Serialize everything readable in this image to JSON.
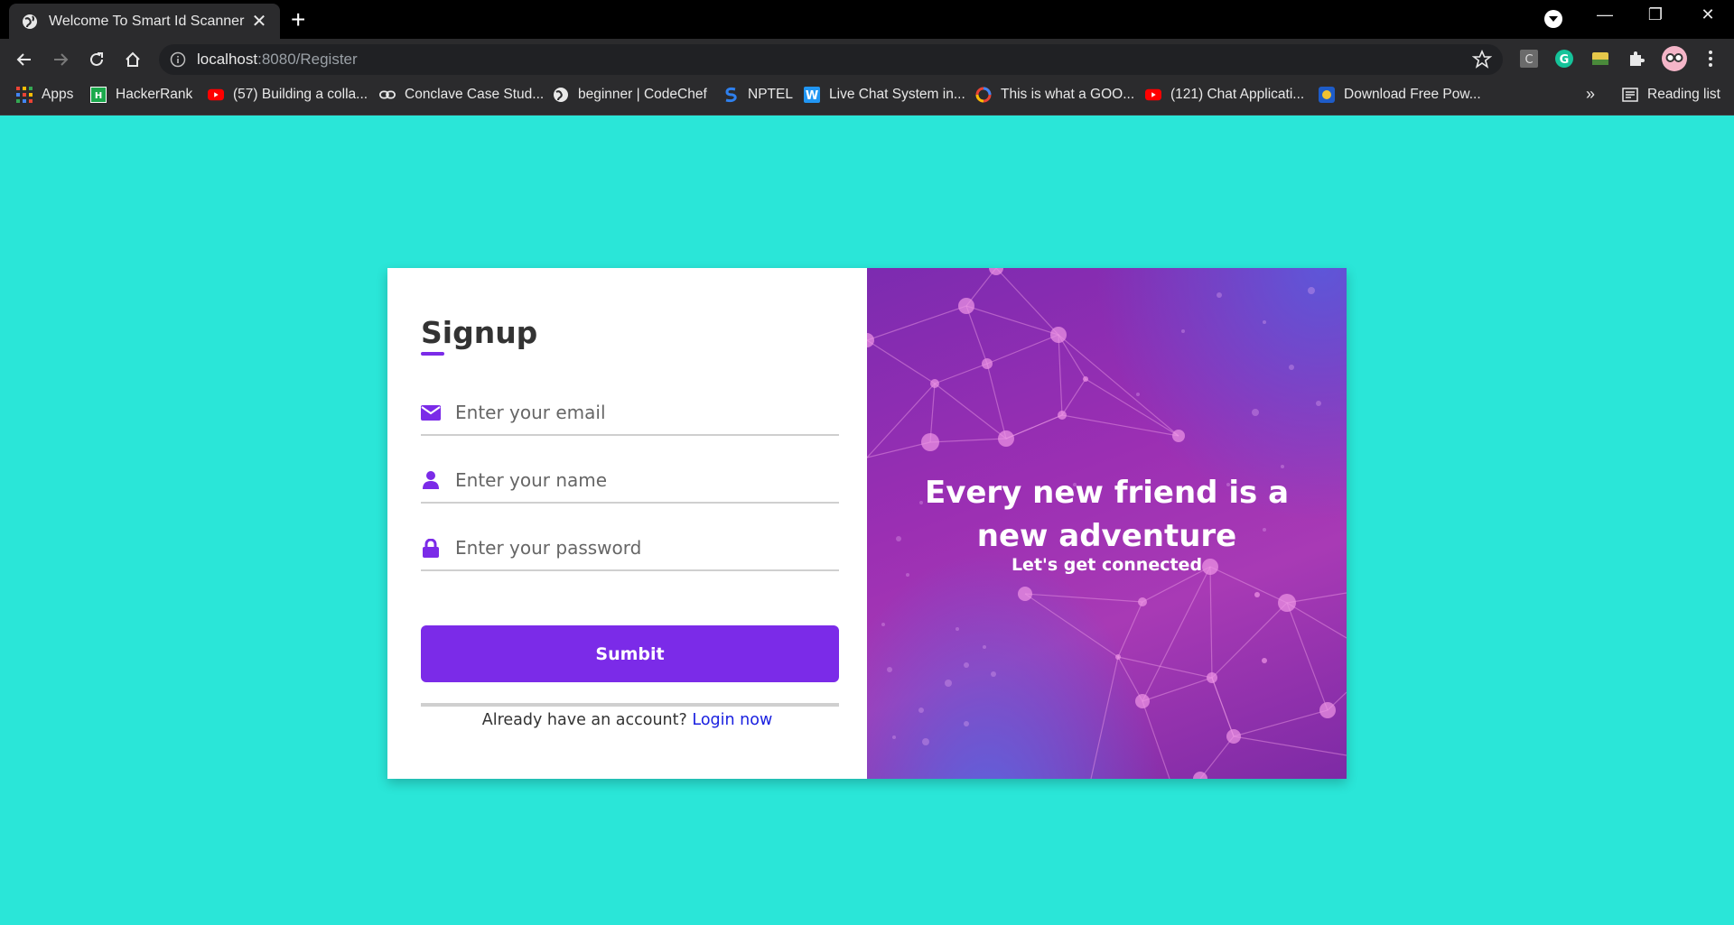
{
  "browser": {
    "tab_title": "Welcome To Smart Id Scanner",
    "tab_close": "✕",
    "new_tab": "+",
    "url_host": "localhost",
    "url_path": ":8080/Register",
    "window_controls": {
      "minimize": "—",
      "restore": "❐",
      "close": "✕"
    }
  },
  "bookmarks": [
    {
      "label": "Apps",
      "icon": "apps-grid-icon"
    },
    {
      "label": "HackerRank",
      "icon": "hackerrank-icon"
    },
    {
      "label": "(57) Building a colla...",
      "icon": "youtube-icon"
    },
    {
      "label": "Conclave Case Stud...",
      "icon": "link-icon"
    },
    {
      "label": "beginner | CodeChef",
      "icon": "globe-icon"
    },
    {
      "label": "NPTEL",
      "icon": "nptel-icon"
    },
    {
      "label": "Live Chat System in...",
      "icon": "w-icon"
    },
    {
      "label": "This is what a GOO...",
      "icon": "google-icon"
    },
    {
      "label": "(121) Chat Applicati...",
      "icon": "youtube-icon"
    },
    {
      "label": "Download Free Pow...",
      "icon": "download-site-icon"
    }
  ],
  "bookmarks_overflow": "»",
  "reading_list": "Reading list",
  "form": {
    "title": "Signup",
    "email_placeholder": "Enter your email",
    "name_placeholder": "Enter your name",
    "password_placeholder": "Enter your password",
    "submit_label": "Sumbit",
    "login_prompt": "Already have an account?",
    "login_link": "Login now"
  },
  "hero": {
    "line1": "Every new friend is a",
    "line2": "new adventure",
    "subtitle": "Let's get connected"
  },
  "colors": {
    "page_background": "#2ae6d8",
    "accent": "#7b2be8",
    "link": "#1a20e0"
  }
}
